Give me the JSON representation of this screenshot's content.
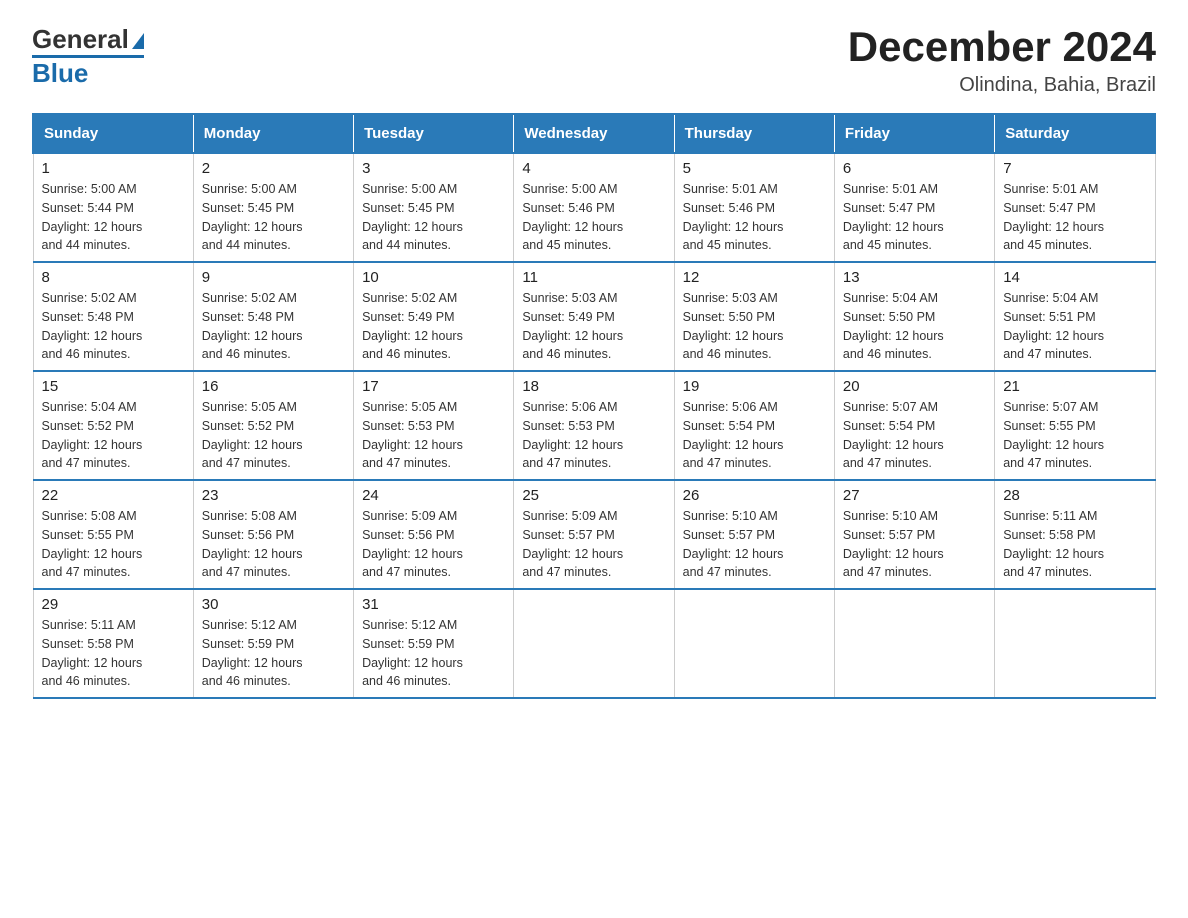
{
  "logo": {
    "general": "General",
    "blue": "Blue"
  },
  "title": "December 2024",
  "subtitle": "Olindina, Bahia, Brazil",
  "days_of_week": [
    "Sunday",
    "Monday",
    "Tuesday",
    "Wednesday",
    "Thursday",
    "Friday",
    "Saturday"
  ],
  "weeks": [
    [
      {
        "day": "1",
        "sunrise": "5:00 AM",
        "sunset": "5:44 PM",
        "daylight": "12 hours and 44 minutes."
      },
      {
        "day": "2",
        "sunrise": "5:00 AM",
        "sunset": "5:45 PM",
        "daylight": "12 hours and 44 minutes."
      },
      {
        "day": "3",
        "sunrise": "5:00 AM",
        "sunset": "5:45 PM",
        "daylight": "12 hours and 44 minutes."
      },
      {
        "day": "4",
        "sunrise": "5:00 AM",
        "sunset": "5:46 PM",
        "daylight": "12 hours and 45 minutes."
      },
      {
        "day": "5",
        "sunrise": "5:01 AM",
        "sunset": "5:46 PM",
        "daylight": "12 hours and 45 minutes."
      },
      {
        "day": "6",
        "sunrise": "5:01 AM",
        "sunset": "5:47 PM",
        "daylight": "12 hours and 45 minutes."
      },
      {
        "day": "7",
        "sunrise": "5:01 AM",
        "sunset": "5:47 PM",
        "daylight": "12 hours and 45 minutes."
      }
    ],
    [
      {
        "day": "8",
        "sunrise": "5:02 AM",
        "sunset": "5:48 PM",
        "daylight": "12 hours and 46 minutes."
      },
      {
        "day": "9",
        "sunrise": "5:02 AM",
        "sunset": "5:48 PM",
        "daylight": "12 hours and 46 minutes."
      },
      {
        "day": "10",
        "sunrise": "5:02 AM",
        "sunset": "5:49 PM",
        "daylight": "12 hours and 46 minutes."
      },
      {
        "day": "11",
        "sunrise": "5:03 AM",
        "sunset": "5:49 PM",
        "daylight": "12 hours and 46 minutes."
      },
      {
        "day": "12",
        "sunrise": "5:03 AM",
        "sunset": "5:50 PM",
        "daylight": "12 hours and 46 minutes."
      },
      {
        "day": "13",
        "sunrise": "5:04 AM",
        "sunset": "5:50 PM",
        "daylight": "12 hours and 46 minutes."
      },
      {
        "day": "14",
        "sunrise": "5:04 AM",
        "sunset": "5:51 PM",
        "daylight": "12 hours and 47 minutes."
      }
    ],
    [
      {
        "day": "15",
        "sunrise": "5:04 AM",
        "sunset": "5:52 PM",
        "daylight": "12 hours and 47 minutes."
      },
      {
        "day": "16",
        "sunrise": "5:05 AM",
        "sunset": "5:52 PM",
        "daylight": "12 hours and 47 minutes."
      },
      {
        "day": "17",
        "sunrise": "5:05 AM",
        "sunset": "5:53 PM",
        "daylight": "12 hours and 47 minutes."
      },
      {
        "day": "18",
        "sunrise": "5:06 AM",
        "sunset": "5:53 PM",
        "daylight": "12 hours and 47 minutes."
      },
      {
        "day": "19",
        "sunrise": "5:06 AM",
        "sunset": "5:54 PM",
        "daylight": "12 hours and 47 minutes."
      },
      {
        "day": "20",
        "sunrise": "5:07 AM",
        "sunset": "5:54 PM",
        "daylight": "12 hours and 47 minutes."
      },
      {
        "day": "21",
        "sunrise": "5:07 AM",
        "sunset": "5:55 PM",
        "daylight": "12 hours and 47 minutes."
      }
    ],
    [
      {
        "day": "22",
        "sunrise": "5:08 AM",
        "sunset": "5:55 PM",
        "daylight": "12 hours and 47 minutes."
      },
      {
        "day": "23",
        "sunrise": "5:08 AM",
        "sunset": "5:56 PM",
        "daylight": "12 hours and 47 minutes."
      },
      {
        "day": "24",
        "sunrise": "5:09 AM",
        "sunset": "5:56 PM",
        "daylight": "12 hours and 47 minutes."
      },
      {
        "day": "25",
        "sunrise": "5:09 AM",
        "sunset": "5:57 PM",
        "daylight": "12 hours and 47 minutes."
      },
      {
        "day": "26",
        "sunrise": "5:10 AM",
        "sunset": "5:57 PM",
        "daylight": "12 hours and 47 minutes."
      },
      {
        "day": "27",
        "sunrise": "5:10 AM",
        "sunset": "5:57 PM",
        "daylight": "12 hours and 47 minutes."
      },
      {
        "day": "28",
        "sunrise": "5:11 AM",
        "sunset": "5:58 PM",
        "daylight": "12 hours and 47 minutes."
      }
    ],
    [
      {
        "day": "29",
        "sunrise": "5:11 AM",
        "sunset": "5:58 PM",
        "daylight": "12 hours and 46 minutes."
      },
      {
        "day": "30",
        "sunrise": "5:12 AM",
        "sunset": "5:59 PM",
        "daylight": "12 hours and 46 minutes."
      },
      {
        "day": "31",
        "sunrise": "5:12 AM",
        "sunset": "5:59 PM",
        "daylight": "12 hours and 46 minutes."
      },
      null,
      null,
      null,
      null
    ]
  ]
}
